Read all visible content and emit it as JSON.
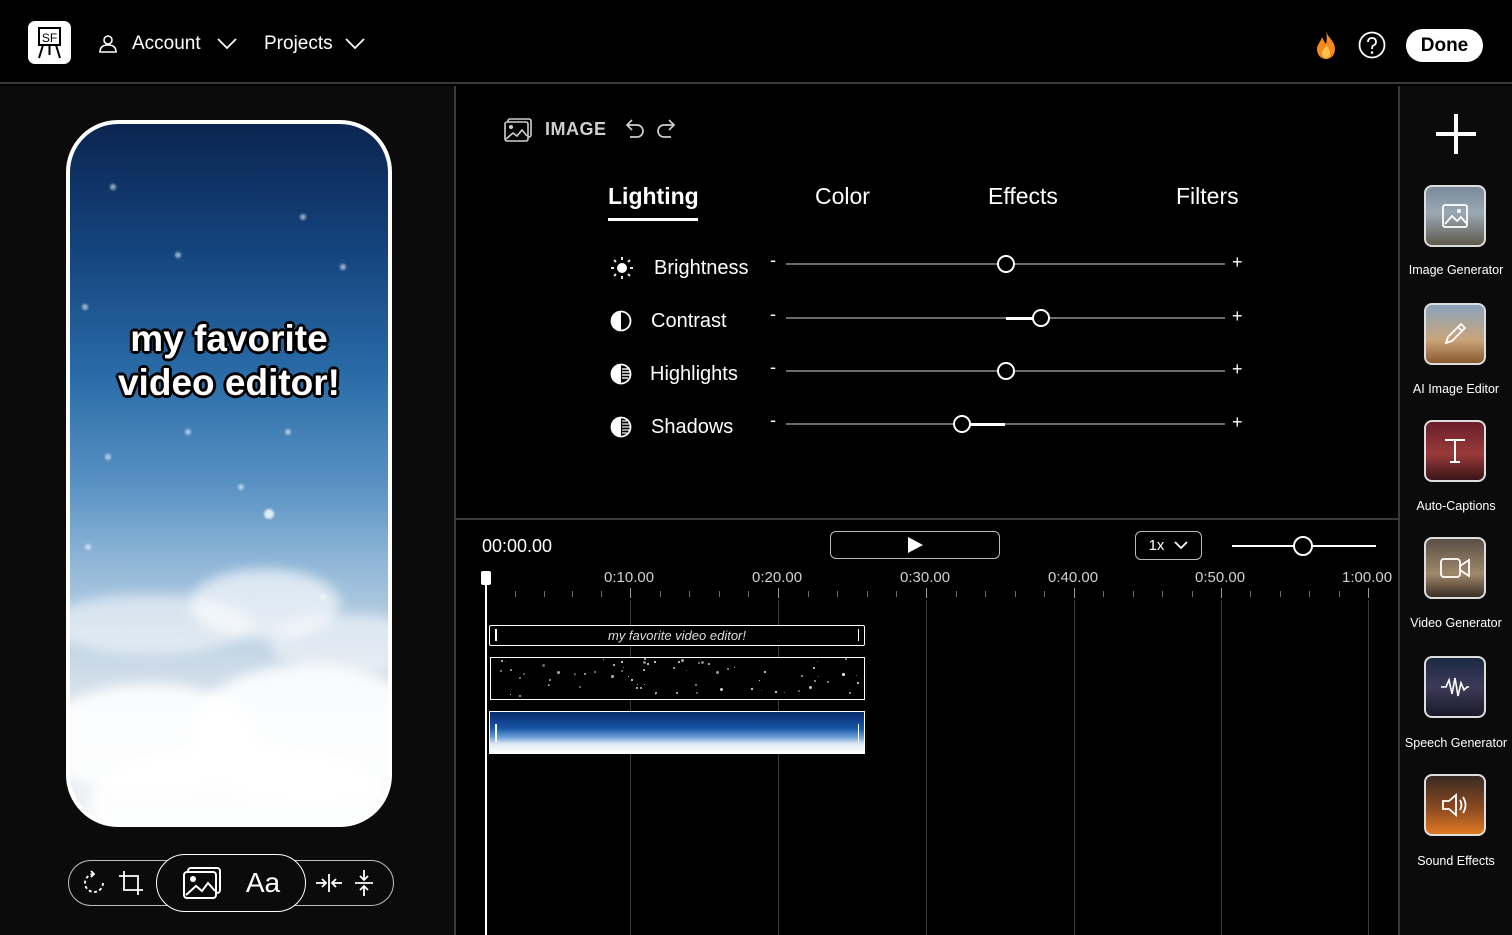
{
  "header": {
    "logo_text": "SF",
    "account_label": "Account",
    "projects_label": "Projects",
    "done_label": "Done",
    "icons": [
      "logo-easel-icon",
      "user-icon",
      "chevron-down-icon",
      "flame-icon",
      "help-icon"
    ]
  },
  "preview": {
    "caption_line1": "my favorite",
    "caption_line2": "video editor!",
    "toolbar_text_tool": "Aa",
    "toolbar_icons": [
      "rotate-icon",
      "crop-icon",
      "image-icon",
      "text-icon",
      "fit-horizontal-icon",
      "fit-vertical-icon"
    ]
  },
  "editor": {
    "section_label": "IMAGE",
    "tabs": [
      {
        "label": "Lighting",
        "active": true
      },
      {
        "label": "Color",
        "active": false
      },
      {
        "label": "Effects",
        "active": false
      },
      {
        "label": "Filters",
        "active": false
      }
    ],
    "minus_symbol": "-",
    "plus_symbol": "+",
    "adjustments": [
      {
        "label": "Brightness",
        "icon": "sun-icon",
        "value": 0.5
      },
      {
        "label": "Contrast",
        "icon": "contrast-icon",
        "value": 0.58
      },
      {
        "label": "Highlights",
        "icon": "highlights-icon",
        "value": 0.5
      },
      {
        "label": "Shadows",
        "icon": "shadows-icon",
        "value": 0.4
      }
    ]
  },
  "timeline": {
    "current_time": "00:00.00",
    "speed": "1x",
    "ticks": [
      "0:10.00",
      "0:20.00",
      "0:30.00",
      "0:40.00",
      "0:50.00",
      "1:00.00"
    ],
    "text_clip_label": "my favorite video editor!"
  },
  "tools": [
    {
      "name": "Image Generator",
      "icon": "image-icon"
    },
    {
      "name": "AI Image Editor",
      "icon": "pencil-icon"
    },
    {
      "name": "Auto-Captions",
      "icon": "text-cursor-icon"
    },
    {
      "name": "Video Generator",
      "icon": "video-icon"
    },
    {
      "name": "Speech Generator",
      "icon": "waveform-icon"
    },
    {
      "name": "Sound Effects",
      "icon": "speaker-icon"
    }
  ],
  "colors": {
    "background": "#000000",
    "panel": "#0b0b0b",
    "divider": "#3a3a3a",
    "accent_flame": "#f58a1f"
  }
}
